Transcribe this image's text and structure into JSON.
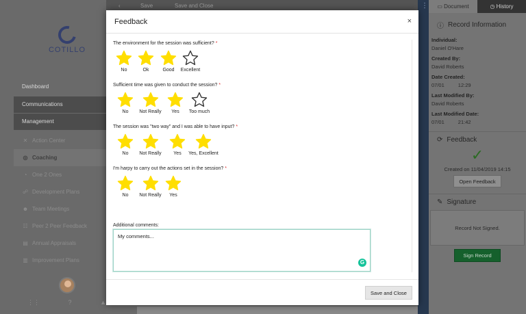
{
  "app": {
    "logo_text": "COTILLO"
  },
  "sidebar": {
    "sections": [
      {
        "label": "Dashboard"
      },
      {
        "label": "Communications"
      },
      {
        "label": "Management"
      }
    ],
    "items": [
      {
        "label": "Action Center",
        "icon": "action-center-icon"
      },
      {
        "label": "Coaching",
        "icon": "coaching-icon"
      },
      {
        "label": "One 2 Ones",
        "icon": "one2one-icon"
      },
      {
        "label": "Development Plans",
        "icon": "development-icon"
      },
      {
        "label": "Team Meetings",
        "icon": "meetings-icon"
      },
      {
        "label": "Peer 2 Peer Feedback",
        "icon": "peer-feedback-icon"
      },
      {
        "label": "Annual Appraisals",
        "icon": "appraisals-icon"
      },
      {
        "label": "Improvement Plans",
        "icon": "improvement-icon"
      }
    ],
    "footer": {
      "grid_icon": "⋮⋮",
      "help_icon": "?",
      "bell_icon": "🔔"
    }
  },
  "toolbar": {
    "back_icon": "‹",
    "save_label": "Save",
    "save_close_label": "Save and Close"
  },
  "right_panel": {
    "tabs": [
      {
        "label": "Document"
      },
      {
        "label": "History"
      }
    ],
    "record_info": {
      "title": "Record Information",
      "individual_label": "Individual:",
      "individual": "Daniel O'Hare",
      "created_by_label": "Created By:",
      "created_by": "David Roberts",
      "date_created_label": "Date Created:",
      "date_created_date": "07/01",
      "date_created_time": "12:29",
      "last_modified_by_label": "Last Modified By:",
      "last_modified_by": "David Roberts",
      "last_modified_date_label": "Last Modified Date:",
      "last_modified_date": "07/01",
      "last_modified_time": "21:42"
    },
    "feedback": {
      "title": "Feedback",
      "created_on": "Created on 11/04/2019 14:15",
      "open_label": "Open Feedback"
    },
    "signature": {
      "title": "Signature",
      "status": "Record Not Signed.",
      "sign_label": "Sign Record"
    }
  },
  "modal": {
    "title": "Feedback",
    "close_label": "×",
    "questions": [
      {
        "text": "The environment for the session was sufficient?",
        "required": "*",
        "options": [
          "No",
          "Ok",
          "Good",
          "Excellent"
        ],
        "rating": 3
      },
      {
        "text": "Sufficient time was given to conduct the session?",
        "required": "*",
        "options": [
          "No",
          "Not Really",
          "Yes",
          "Too much"
        ],
        "rating": 3
      },
      {
        "text": "The session was \"two way\" and I was able to have input?",
        "required": "*",
        "options": [
          "No",
          "Not Really",
          "Yes",
          "Yes, Excellent"
        ],
        "rating": 4
      },
      {
        "text": "I'm harpy to carry out the actions set in the session?",
        "required": "*",
        "options": [
          "No",
          "Not Really",
          "Yes"
        ],
        "rating": 3
      }
    ],
    "comments_label": "Additional comments:",
    "comments_value": "My comments...",
    "save_close_label": "Save and Close"
  },
  "colors": {
    "star_filled": "#FFDE00",
    "star_outline": "#333333",
    "sign_green": "#15602c"
  }
}
